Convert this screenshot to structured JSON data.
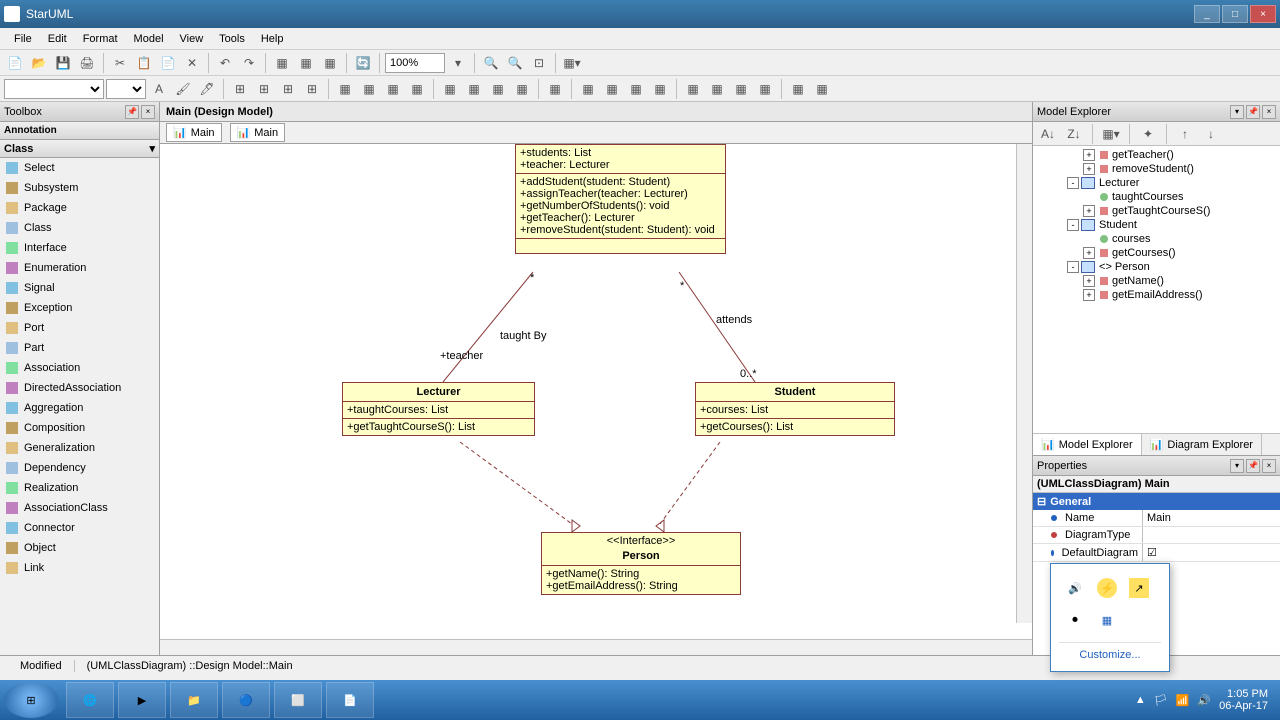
{
  "window": {
    "title": "StarUML",
    "minimize": "_",
    "maximize": "□",
    "close": "×"
  },
  "menubar": [
    "File",
    "Edit",
    "Format",
    "Model",
    "View",
    "Tools",
    "Help"
  ],
  "toolbar1": {
    "zoom": "100%"
  },
  "toolbox": {
    "title": "Toolbox",
    "section_annotation": "Annotation",
    "section_class": "Class",
    "items": [
      "Select",
      "Subsystem",
      "Package",
      "Class",
      "Interface",
      "Enumeration",
      "Signal",
      "Exception",
      "Port",
      "Part",
      "Association",
      "DirectedAssociation",
      "Aggregation",
      "Composition",
      "Generalization",
      "Dependency",
      "Realization",
      "AssociationClass",
      "Connector",
      "Object",
      "Link"
    ]
  },
  "canvas": {
    "tab_title": "Main (Design Model)",
    "subtabs": [
      "Main",
      "Main"
    ]
  },
  "diagram": {
    "top_class": {
      "attrs": [
        "+students: List",
        "+teacher: Lecturer"
      ],
      "ops": [
        "+addStudent(student: Student)",
        "+assignTeacher(teacher: Lecturer)",
        "+getNumberOfStudents(): void",
        "+getTeacher(): Lecturer",
        "+removeStudent(student: Student): void"
      ]
    },
    "lecturer": {
      "name": "Lecturer",
      "attrs": [
        "+taughtCourses: List"
      ],
      "ops": [
        "+getTaughtCourseS(): List"
      ]
    },
    "student": {
      "name": "Student",
      "attrs": [
        "+courses: List"
      ],
      "ops": [
        "+getCourses(): List"
      ]
    },
    "person": {
      "stereotype": "<<Interface>>",
      "name": "Person",
      "ops": [
        "+getName(): String",
        "+getEmailAddress(): String"
      ]
    },
    "labels": {
      "taughtBy": "taught By",
      "teacher": "+teacher",
      "attends": "attends",
      "mult1": "*",
      "mult2": "*",
      "mult3": "0..*"
    }
  },
  "model_explorer": {
    "title": "Model Explorer",
    "items": [
      {
        "indent": 3,
        "expand": "+",
        "icon": "op",
        "label": "getTeacher()"
      },
      {
        "indent": 3,
        "expand": "+",
        "icon": "op",
        "label": "removeStudent()"
      },
      {
        "indent": 2,
        "expand": "-",
        "icon": "class",
        "label": "Lecturer"
      },
      {
        "indent": 3,
        "expand": "",
        "icon": "attr",
        "label": "taughtCourses"
      },
      {
        "indent": 3,
        "expand": "+",
        "icon": "op",
        "label": "getTaughtCourseS()"
      },
      {
        "indent": 2,
        "expand": "-",
        "icon": "class",
        "label": "Student"
      },
      {
        "indent": 3,
        "expand": "",
        "icon": "attr",
        "label": "courses"
      },
      {
        "indent": 3,
        "expand": "+",
        "icon": "op",
        "label": "getCourses()"
      },
      {
        "indent": 2,
        "expand": "-",
        "icon": "class",
        "label": "<<Interface>> Person"
      },
      {
        "indent": 3,
        "expand": "+",
        "icon": "op",
        "label": "getName()"
      },
      {
        "indent": 3,
        "expand": "+",
        "icon": "op",
        "label": "getEmailAddress()"
      }
    ],
    "tabs": [
      "Model Explorer",
      "Diagram Explorer"
    ]
  },
  "properties": {
    "title": "Properties",
    "object": "(UMLClassDiagram) Main",
    "group": "General",
    "rows": [
      {
        "name": "Name",
        "value": "Main",
        "dot": "#2060c0"
      },
      {
        "name": "DiagramType",
        "value": "",
        "dot": "#c04040"
      },
      {
        "name": "DefaultDiagram",
        "value": "☑",
        "dot": "#2060c0"
      }
    ]
  },
  "statusbar": {
    "modified": "Modified",
    "path": "(UMLClassDiagram) ::Design Model::Main"
  },
  "taskbar": {
    "time": "1:05 PM",
    "date": "06-Apr-17"
  },
  "tray_popup": {
    "customize": "Customize..."
  }
}
